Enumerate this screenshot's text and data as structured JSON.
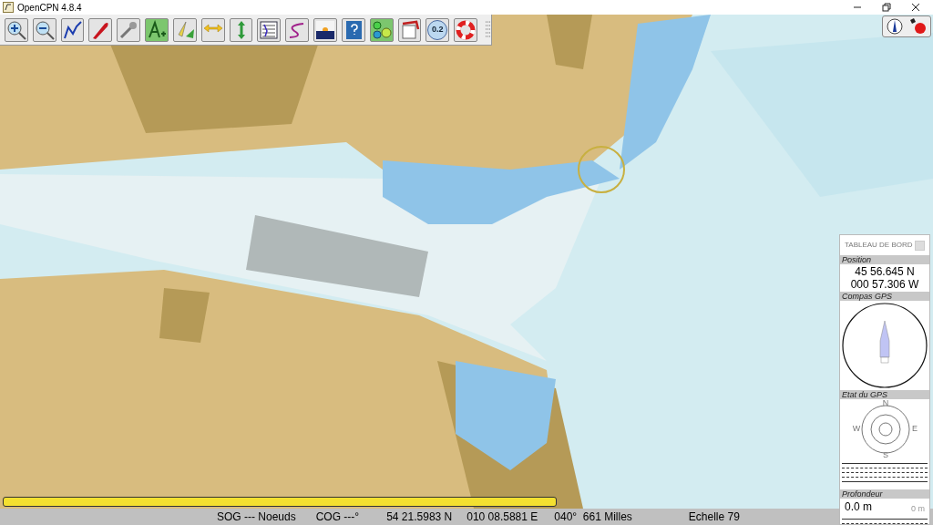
{
  "window": {
    "title": "OpenCPN 4.8.4"
  },
  "toolbar": {
    "tide_value": "0.2"
  },
  "dashboard": {
    "title": "TABLEAU DE BORD",
    "instruments": [
      {
        "kind": "position",
        "label": "Position",
        "lines": [
          "45 56.645 N",
          "000 57.306 W"
        ]
      },
      {
        "kind": "compass",
        "label": "Compas GPS"
      },
      {
        "kind": "gps",
        "label": "Etat du GPS",
        "cardinals": [
          "N",
          "E",
          "S",
          "W"
        ]
      },
      {
        "kind": "depth",
        "label": "Profondeur",
        "value": "0.0 m",
        "scale": "0 m"
      }
    ]
  },
  "status_bar": [
    "SOG --- Noeuds",
    "COG ---°",
    "54 21.5983 N",
    "010 08.5881 E",
    "040°  661 Milles",
    "Echelle 79"
  ]
}
